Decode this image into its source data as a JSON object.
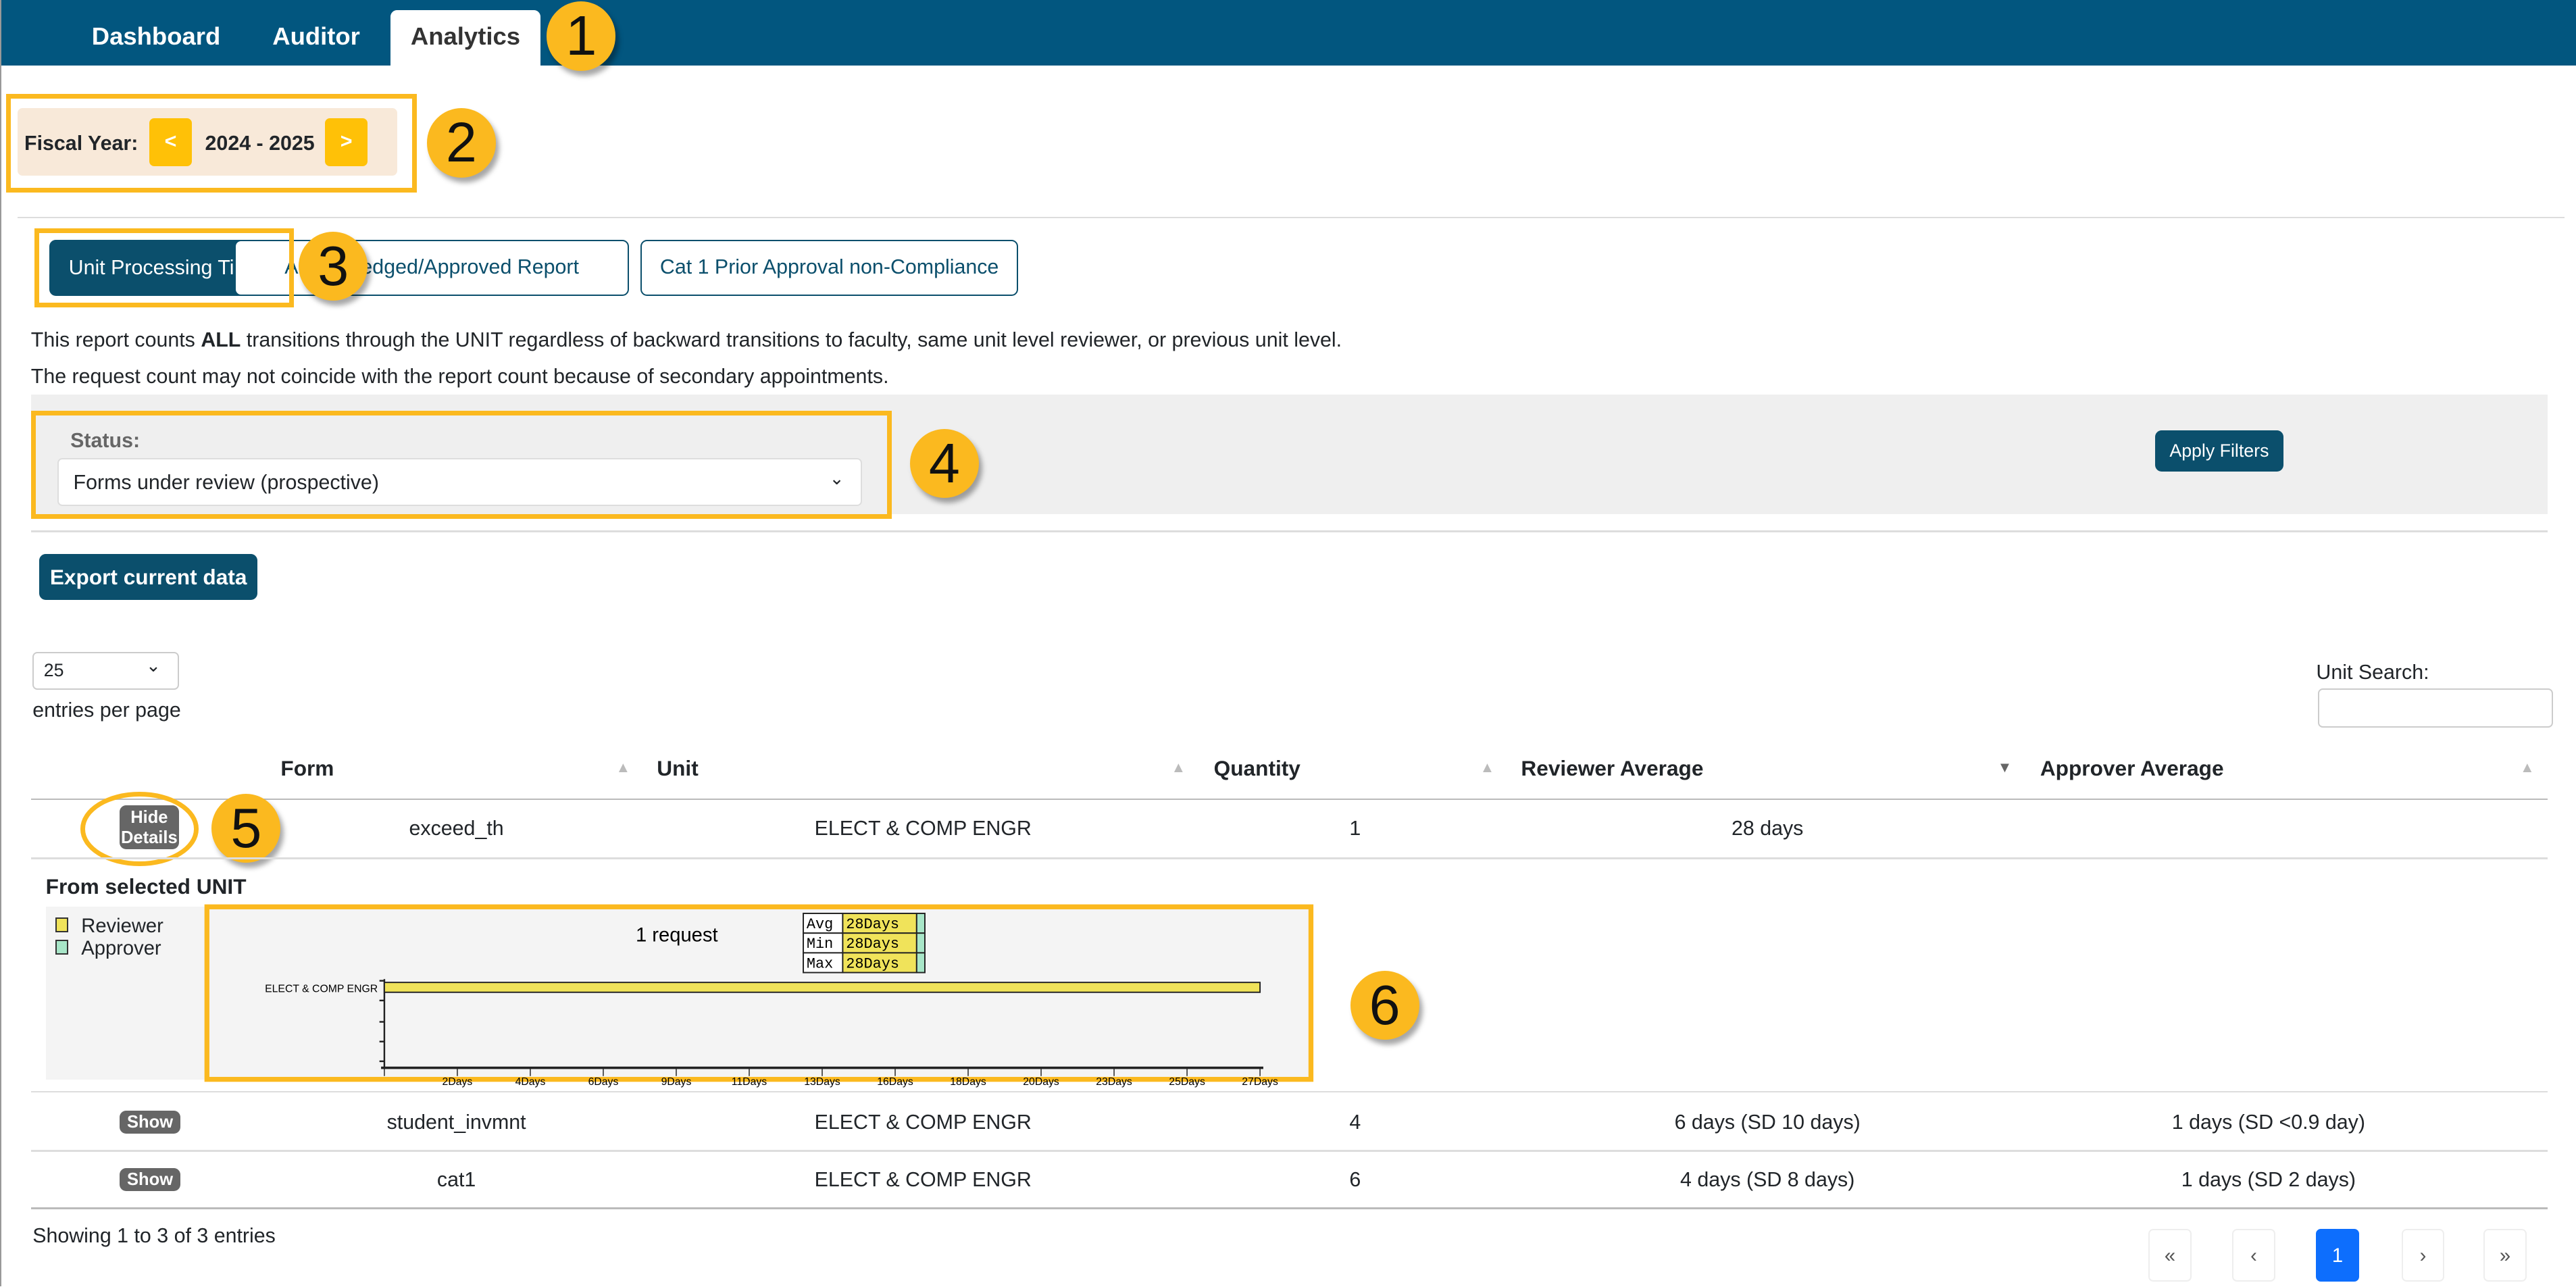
{
  "nav": {
    "tabs": [
      {
        "label": "Dashboard"
      },
      {
        "label": "Auditor"
      },
      {
        "label": "Analytics",
        "active": true
      }
    ]
  },
  "callouts": [
    "1",
    "2",
    "3",
    "4",
    "5",
    "6"
  ],
  "fiscal": {
    "label": "Fiscal Year:",
    "prev": "<",
    "value": "2024 - 2025",
    "next": ">"
  },
  "reports": [
    {
      "label": "Unit Processing Time",
      "active": true
    },
    {
      "label": "Acknowledged/Approved Report"
    },
    {
      "label": "Cat 1 Prior Approval non-Compliance"
    }
  ],
  "notes": {
    "line1_pre": "This report counts ",
    "line1_bold": "ALL",
    "line1_post": " transitions through the UNIT regardless of backward transitions to faculty, same unit level reviewer, or previous unit level.",
    "line2": "The request count may not coincide with the report count because of secondary appointments."
  },
  "filters": {
    "status_label": "Status:",
    "status_value": "Forms under review (prospective)",
    "apply": "Apply Filters"
  },
  "export": "Export current data",
  "table": {
    "page_size": "25",
    "entries_label": "entries per page",
    "search_label": "Unit Search:",
    "search_value": "",
    "headers": [
      "Form",
      "Unit",
      "Quantity",
      "Reviewer Average",
      "Approver Average"
    ],
    "rows": [
      {
        "toggle": "Hide Details",
        "form": "exceed_th",
        "unit": "ELECT & COMP ENGR",
        "quantity": "1",
        "reviewer": "28 days",
        "approver": ""
      },
      {
        "toggle": "Show",
        "form": "student_invmnt",
        "unit": "ELECT & COMP ENGR",
        "quantity": "4",
        "reviewer": "6 days (SD 10 days)",
        "approver": "1 days (SD <0.9 day)"
      },
      {
        "toggle": "Show",
        "form": "cat1",
        "unit": "ELECT & COMP ENGR",
        "quantity": "6",
        "reviewer": "4 days (SD 8 days)",
        "approver": "1 days (SD 2 days)"
      }
    ],
    "footer": "Showing 1 to 3 of 3 entries",
    "pagination": [
      "«",
      "‹",
      "1",
      "›",
      "»"
    ]
  },
  "details": {
    "title": "From selected UNIT",
    "legend": [
      {
        "name": "Reviewer",
        "color": "#f0e35a"
      },
      {
        "name": "Approver",
        "color": "#a8e6c8"
      }
    ]
  },
  "chart_data": {
    "type": "bar",
    "orientation": "horizontal",
    "title": "1 request",
    "categories": [
      "ELECT & COMP ENGR"
    ],
    "series": [
      {
        "name": "Reviewer",
        "values": [
          28
        ]
      }
    ],
    "xlim": [
      0,
      28
    ],
    "xticks": [
      "2Days",
      "4Days",
      "6Days",
      "9Days",
      "11Days",
      "13Days",
      "16Days",
      "18Days",
      "20Days",
      "23Days",
      "25Days",
      "27Days"
    ],
    "tooltip": [
      {
        "k": "Avg",
        "v": "28Days"
      },
      {
        "k": "Min",
        "v": "28Days"
      },
      {
        "k": "Max",
        "v": "28Days"
      }
    ]
  }
}
